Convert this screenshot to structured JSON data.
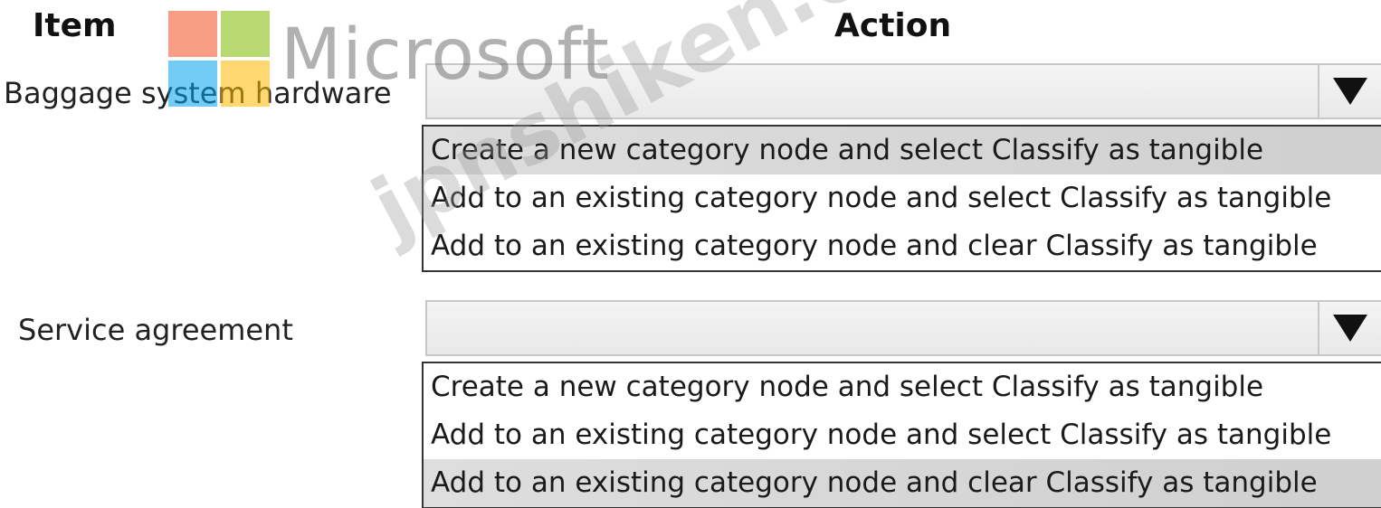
{
  "header": {
    "item_label": "Item",
    "action_label": "Action"
  },
  "watermarks": {
    "logo_icon": "microsoft-logo-icon",
    "brand_text": "Microsoft",
    "site_text": "jpnshiken.com"
  },
  "rows": [
    {
      "item": "Baggage system hardware",
      "dropdown": {
        "selected_value": "",
        "options": [
          {
            "label": "Create a new category node and select Classify as tangible",
            "highlighted": true
          },
          {
            "label": "Add to an existing category node and select Classify as tangible",
            "highlighted": false
          },
          {
            "label": "Add to an existing category node and clear Classify as tangible",
            "highlighted": false
          }
        ]
      }
    },
    {
      "item": "Service agreement",
      "dropdown": {
        "selected_value": "",
        "options": [
          {
            "label": "Create a new category node and select Classify as tangible",
            "highlighted": false
          },
          {
            "label": "Add to an existing category node and select Classify as tangible",
            "highlighted": false
          },
          {
            "label": "Add to an existing category node and clear Classify as tangible",
            "highlighted": true
          }
        ]
      }
    }
  ]
}
